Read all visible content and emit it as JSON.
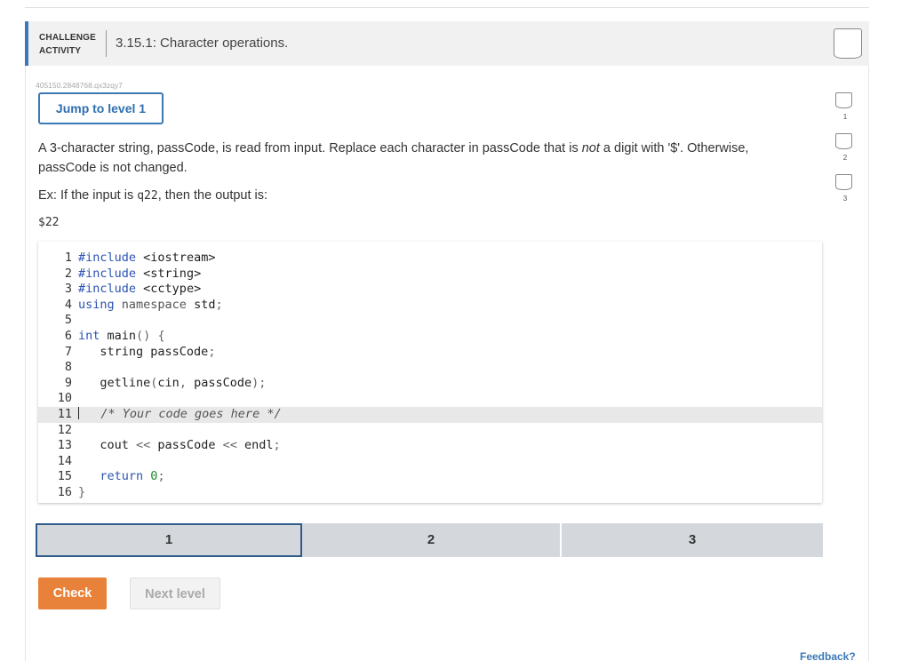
{
  "header": {
    "label_line1": "CHALLENGE",
    "label_line2": "ACTIVITY",
    "title": "3.15.1: Character operations."
  },
  "meta": {
    "id": "405150.2848768.qx3zqy7"
  },
  "jump_button": "Jump to level 1",
  "side_levels": [
    "1",
    "2",
    "3"
  ],
  "description": {
    "part1": "A 3-character string, passCode, is read from input. Replace each character in passCode that is ",
    "em": "not",
    "part2": " a digit with '$'. Otherwise, passCode is not changed."
  },
  "example": {
    "prefix": "Ex: If the input is ",
    "input": "q22",
    "suffix": ", then the output is:",
    "output": "$22"
  },
  "code_lines": [
    {
      "n": "1",
      "tokens": [
        [
          "kw",
          "#include"
        ],
        [
          "",
          "  "
        ],
        [
          "",
          "<iostream>"
        ]
      ]
    },
    {
      "n": "2",
      "tokens": [
        [
          "kw",
          "#include"
        ],
        [
          "",
          ""
        ],
        [
          "",
          "<string>"
        ]
      ]
    },
    {
      "n": "3",
      "tokens": [
        [
          "kw",
          "#include"
        ],
        [
          "",
          ""
        ],
        [
          "",
          "<cctype>"
        ]
      ]
    },
    {
      "n": "4",
      "tokens": [
        [
          "kw",
          "using"
        ],
        [
          "",
          " "
        ],
        [
          "ns",
          "namespace"
        ],
        [
          "",
          " std"
        ],
        [
          "op",
          ";"
        ]
      ]
    },
    {
      "n": "5",
      "tokens": []
    },
    {
      "n": "6",
      "tokens": [
        [
          "ty",
          "int"
        ],
        [
          "",
          " main"
        ],
        [
          "op",
          "()"
        ],
        [
          "",
          " "
        ],
        [
          "op",
          "{"
        ]
      ]
    },
    {
      "n": "7",
      "tokens": [
        [
          "",
          "   string passCode"
        ],
        [
          "op",
          ";"
        ]
      ]
    },
    {
      "n": "8",
      "tokens": []
    },
    {
      "n": "9",
      "tokens": [
        [
          "",
          "   getline"
        ],
        [
          "op",
          "("
        ],
        [
          "",
          "cin"
        ],
        [
          "op",
          ","
        ],
        [
          "",
          " passCode"
        ],
        [
          "op",
          ");"
        ]
      ]
    },
    {
      "n": "10",
      "tokens": []
    },
    {
      "n": "11",
      "tokens": [
        [
          "cm",
          "   /* Your code goes here */"
        ]
      ],
      "active": true
    },
    {
      "n": "12",
      "tokens": []
    },
    {
      "n": "13",
      "tokens": [
        [
          "",
          "   cout "
        ],
        [
          "op",
          "<<"
        ],
        [
          "",
          " passCode "
        ],
        [
          "op",
          "<<"
        ],
        [
          "",
          " endl"
        ],
        [
          "op",
          ";"
        ]
      ]
    },
    {
      "n": "14",
      "tokens": []
    },
    {
      "n": "15",
      "tokens": [
        [
          "kw",
          "   return"
        ],
        [
          "",
          " "
        ],
        [
          "num",
          "0"
        ],
        [
          "op",
          ";"
        ]
      ]
    },
    {
      "n": "16",
      "tokens": [
        [
          "op",
          "}"
        ]
      ]
    }
  ],
  "level_tabs": [
    "1",
    "2",
    "3"
  ],
  "buttons": {
    "check": "Check",
    "next": "Next level"
  },
  "feedback": "Feedback?",
  "colors": {
    "accent": "#3b78b5",
    "check_button": "#e8823a"
  }
}
